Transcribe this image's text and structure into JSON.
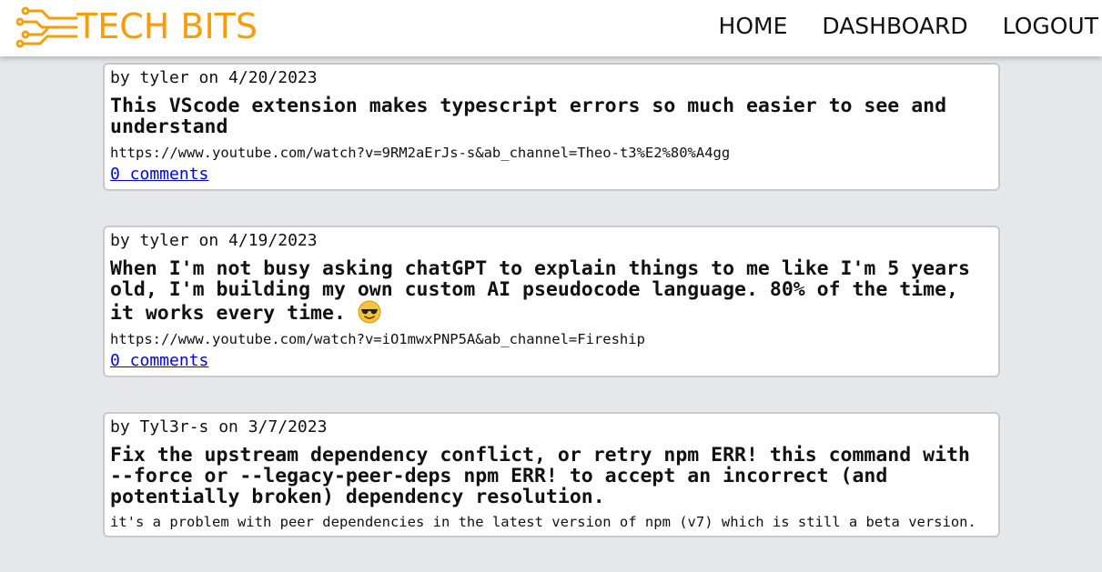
{
  "brand": {
    "name": "TECH BITS",
    "color": "#f59e0b"
  },
  "nav": {
    "home": "HOME",
    "dashboard": "DASHBOARD",
    "logout": "LOGOUT"
  },
  "posts": [
    {
      "author_line": "by tyler on 4/20/2023",
      "title": "This VScode extension makes typescript errors so much easier to see and understand",
      "url": "https://www.youtube.com/watch?v=9RM2aErJs-s&ab_channel=Theo-t3%E2%80%A4gg",
      "comments": "0 comments"
    },
    {
      "author_line": "by tyler on 4/19/2023",
      "title": "When I'm not busy asking chatGPT to explain things to me like I'm 5 years old, I'm building my own custom AI pseudocode language. 80% of the time, it works every time.",
      "emoji": "sunglasses-face-icon",
      "url": "https://www.youtube.com/watch?v=iO1mwxPNP5A&ab_channel=Fireship",
      "comments": "0 comments"
    },
    {
      "author_line": "by Tyl3r-s on 3/7/2023",
      "title": "Fix the upstream dependency conflict, or retry npm ERR! this command with --force or --legacy-peer-deps npm ERR! to accept an incorrect (and potentially broken) dependency resolution.",
      "body": "it's a problem with peer dependencies in the latest version of npm (v7) which is still a beta version."
    }
  ]
}
